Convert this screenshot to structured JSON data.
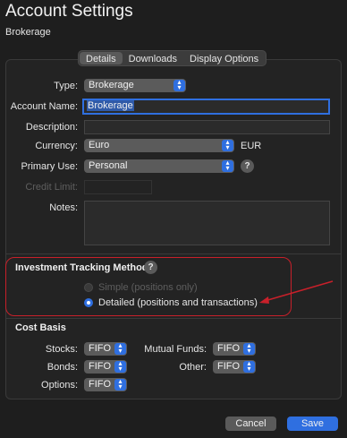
{
  "window": {
    "title": "Account Settings",
    "subtitle": "Brokerage"
  },
  "tabs": [
    {
      "label": "Details",
      "active": true
    },
    {
      "label": "Downloads",
      "active": false
    },
    {
      "label": "Display Options",
      "active": false
    }
  ],
  "details": {
    "type_label": "Type:",
    "type_value": "Brokerage",
    "account_name_label": "Account Name:",
    "account_name_value": "Brokerage",
    "description_label": "Description:",
    "description_value": "",
    "currency_label": "Currency:",
    "currency_value": "Euro",
    "currency_code": "EUR",
    "primary_use_label": "Primary Use:",
    "primary_use_value": "Personal",
    "credit_limit_label": "Credit Limit:",
    "credit_limit_value": "",
    "notes_label": "Notes:",
    "notes_value": ""
  },
  "investment": {
    "title": "Investment Tracking Method",
    "option_simple": "Simple (positions only)",
    "option_detailed": "Detailed (positions and transactions)",
    "selected": "detailed"
  },
  "cost_basis": {
    "title": "Cost Basis",
    "stocks_label": "Stocks:",
    "stocks_value": "FIFO",
    "bonds_label": "Bonds:",
    "bonds_value": "FIFO",
    "options_label": "Options:",
    "options_value": "FIFO",
    "mutual_funds_label": "Mutual Funds:",
    "mutual_funds_value": "FIFO",
    "other_label": "Other:",
    "other_value": "FIFO"
  },
  "buttons": {
    "cancel": "Cancel",
    "save": "Save"
  },
  "help_glyph": "?",
  "chevron_glyph": "⌃⌄",
  "colors": {
    "accent": "#2f6fe0",
    "annotation": "#c8202a",
    "background": "#1e1e1e"
  }
}
